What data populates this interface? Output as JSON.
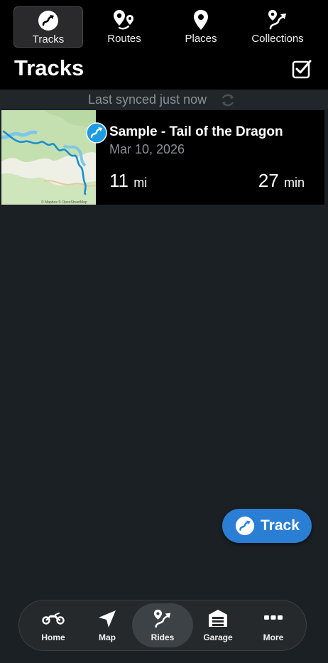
{
  "tabs": [
    {
      "label": "Tracks",
      "icon": "track-arrow-icon",
      "active": true
    },
    {
      "label": "Routes",
      "icon": "route-pins-icon",
      "active": false
    },
    {
      "label": "Places",
      "icon": "place-pin-icon",
      "active": false
    },
    {
      "label": "Collections",
      "icon": "collection-route-icon",
      "active": false
    }
  ],
  "header": {
    "title": "Tracks",
    "select_icon": "checkbox-checked-icon"
  },
  "sync": {
    "text": "Last synced just now",
    "icon": "sync-icon"
  },
  "track": {
    "name": "Sample - Tail of the Dragon",
    "date": "Mar 10, 2026",
    "distance_value": "11",
    "distance_unit": "mi",
    "duration_value": "27",
    "duration_unit": "min",
    "map_attribution": "© Mapbox © OpenStreetMap"
  },
  "fab": {
    "label": "Track",
    "icon": "track-arrow-icon"
  },
  "bottom_nav": [
    {
      "label": "Home",
      "icon": "motorcycle-icon",
      "active": false
    },
    {
      "label": "Map",
      "icon": "navigation-arrow-icon",
      "active": false
    },
    {
      "label": "Rides",
      "icon": "route-icon",
      "active": true
    },
    {
      "label": "Garage",
      "icon": "garage-icon",
      "active": false
    },
    {
      "label": "More",
      "icon": "more-dots-icon",
      "active": false
    }
  ],
  "colors": {
    "accent": "#2a7fd4",
    "badge": "#1f9be0",
    "background": "#1b2024"
  }
}
